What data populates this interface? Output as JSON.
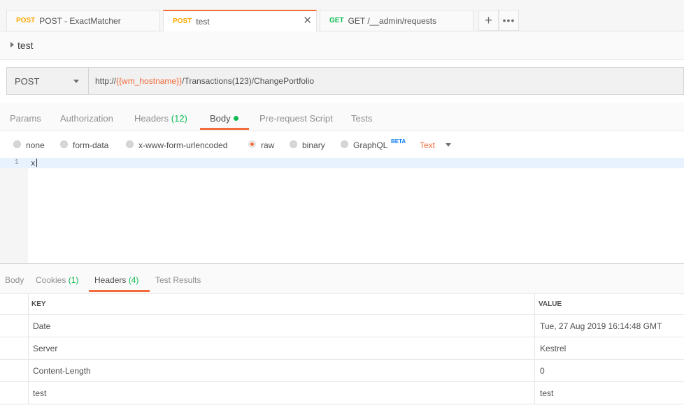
{
  "request_tabs": [
    {
      "method": "POST",
      "label": "POST - ExactMatcher"
    },
    {
      "method": "POST",
      "label": "test",
      "active": true
    },
    {
      "method": "GET",
      "label": "GET /__admin/requests"
    }
  ],
  "tab_actions": {
    "add_icon": "plus-icon",
    "more_icon": "ellipsis-icon"
  },
  "request_name": "test",
  "url_bar": {
    "method": "POST",
    "url_prefix": "http://",
    "url_variable": "{{wm_hostname}}",
    "url_suffix": "/Transactions(123)/ChangePortfolio"
  },
  "request_subtabs": {
    "params": "Params",
    "authorization": "Authorization",
    "headers": "Headers",
    "headers_count": "(12)",
    "body": "Body",
    "prerequest": "Pre-request Script",
    "tests": "Tests"
  },
  "body_types": {
    "none": "none",
    "form_data": "form-data",
    "urlencoded": "x-www-form-urlencoded",
    "raw": "raw",
    "binary": "binary",
    "graphql": "GraphQL",
    "beta": "BETA",
    "selected": "raw",
    "format": "Text"
  },
  "editor": {
    "line_number": "1",
    "content": "x"
  },
  "response_tabs": {
    "body": "Body",
    "cookies": "Cookies",
    "cookies_count": "(1)",
    "headers": "Headers",
    "headers_count": "(4)",
    "test_results": "Test Results"
  },
  "response_headers": {
    "key_header": "KEY",
    "value_header": "VALUE",
    "rows": [
      {
        "key": "Date",
        "value": "Tue, 27 Aug 2019 16:14:48 GMT"
      },
      {
        "key": "Server",
        "value": "Kestrel"
      },
      {
        "key": "Content-Length",
        "value": "0"
      },
      {
        "key": "test",
        "value": "test"
      }
    ]
  },
  "colors": {
    "accent": "#f26b3a",
    "post": "#ffa800",
    "get": "#0cbb52",
    "count": "#0cbb52",
    "beta": "#097bed"
  }
}
